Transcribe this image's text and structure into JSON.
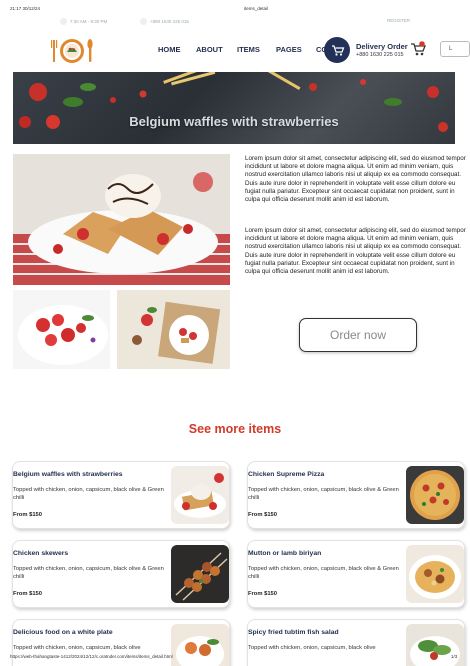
{
  "print": {
    "datetime": "21:17 30/12/24",
    "title": "items_detail",
    "url": "https://web-thahangtaste-1412/2024/12/12/c.oratnder.com/items/items_detail.html",
    "page": "1/3"
  },
  "topbar": {
    "hours": "7:30 AM - 9:30 PM",
    "phone": "+880 1630 225 015",
    "register": "REGISTER"
  },
  "nav": {
    "items": [
      "HOME",
      "ABOUT",
      "ITEMS",
      "PAGES",
      "CO"
    ],
    "delivery_label": "Delivery Order",
    "delivery_phone": "+880 1630 225 015",
    "login": "L"
  },
  "hero": {
    "title": "Belgium waffles with strawberries"
  },
  "description": {
    "p1": "Lorem ipsum dolor sit amet, consectetur adipiscing elit, sed do eiusmod tempor incididunt ut labore et dolore magna aliqua. Ut enim ad minim veniam, quis nostrud exercitation ullamco laboris nisi ut aliquip ex ea commodo consequat. Duis aute irure dolor in reprehenderit in voluptate velit esse cillum dolore eu fugiat nulla pariatur. Excepteur sint occaecat cupidatat non proident, sunt in culpa qui officia deserunt mollit anim id est laborum.",
    "p2": "Lorem ipsum dolor sit amet, consectetur adipiscing elit, sed do eiusmod tempor incididunt ut labore et dolore magna aliqua. Ut enim ad minim veniam, quis nostrud exercitation ullamco laboris nisi ut aliquip ex ea commodo consequat. Duis aute irure dolor in reprehenderit in voluptate velit esse cillum dolore eu fugiat nulla pariatur. Excepteur sint occaecat cupidatat non proident, sunt in culpa qui officia deserunt mollit anim id est laborum."
  },
  "order_button": "Order now",
  "see_more": "See more items",
  "items": [
    {
      "name": "Belgium waffles with strawberries",
      "desc": "Topped with chicken, onion, capsicum, black olive & Green chilli",
      "price": "From $150"
    },
    {
      "name": "Chicken Supreme Pizza",
      "desc": "Topped with chicken, onion, capsicum, black olive & Green chilli",
      "price": "From $150"
    },
    {
      "name": "Chicken skewers",
      "desc": "Topped with chicken, onion, capsicum, black olive & Green chilli",
      "price": "From $150"
    },
    {
      "name": "Mutton or lamb biriyan",
      "desc": "Topped with chicken, onion, capsicum, black olive & Green chilli",
      "price": "From $150"
    },
    {
      "name": "Delicious food on a white plate",
      "desc": "Topped with chicken, onion, capsicum, black olive",
      "price": ""
    },
    {
      "name": "Spicy fried tubtim fish salad",
      "desc": "Topped with chicken, onion, capsicum, black olive",
      "price": ""
    }
  ],
  "colors": {
    "navy": "#1f2d4d",
    "accent_red": "#d23a2a"
  }
}
